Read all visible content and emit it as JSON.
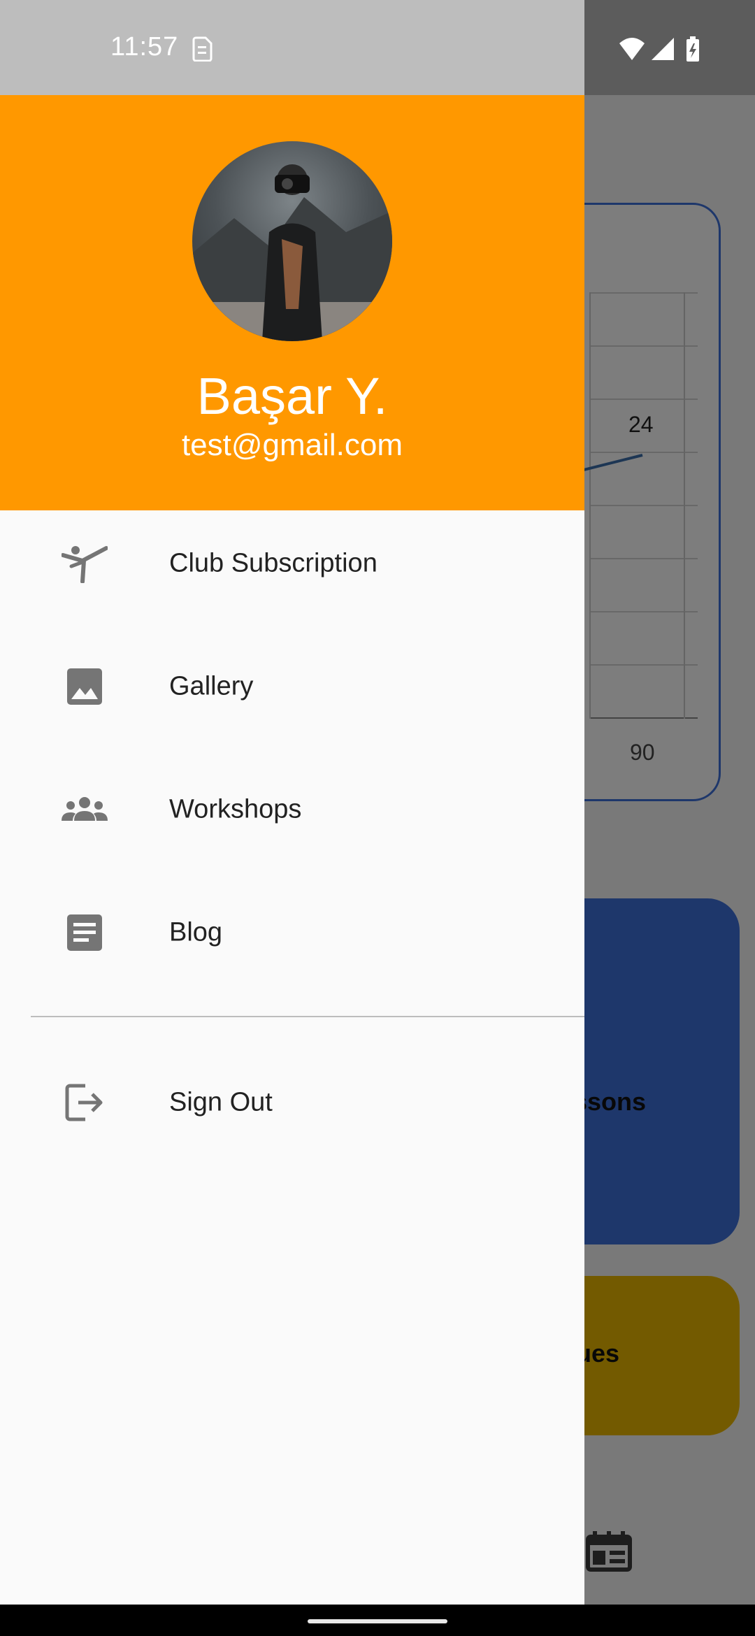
{
  "status_bar": {
    "time": "11:57",
    "icons": [
      "sim-card-icon",
      "wifi-icon",
      "signal-icon",
      "battery-charging-icon"
    ]
  },
  "drawer": {
    "header_color": "#ff9800",
    "user": {
      "name": "Başar Y.",
      "email": "test@gmail.com"
    },
    "menu": [
      {
        "label": "Club Subscription",
        "icon": "gymnastics-icon"
      },
      {
        "label": "Gallery",
        "icon": "image-icon"
      },
      {
        "label": "Workshops",
        "icon": "groups-icon"
      },
      {
        "label": "Blog",
        "icon": "article-icon"
      }
    ],
    "sign_out": {
      "label": "Sign Out",
      "icon": "logout-icon"
    }
  },
  "background": {
    "chart": {
      "value_label": "24",
      "x_tick": "90"
    },
    "cards": {
      "blue_text": "ssons",
      "yellow_text": "ues"
    }
  }
}
